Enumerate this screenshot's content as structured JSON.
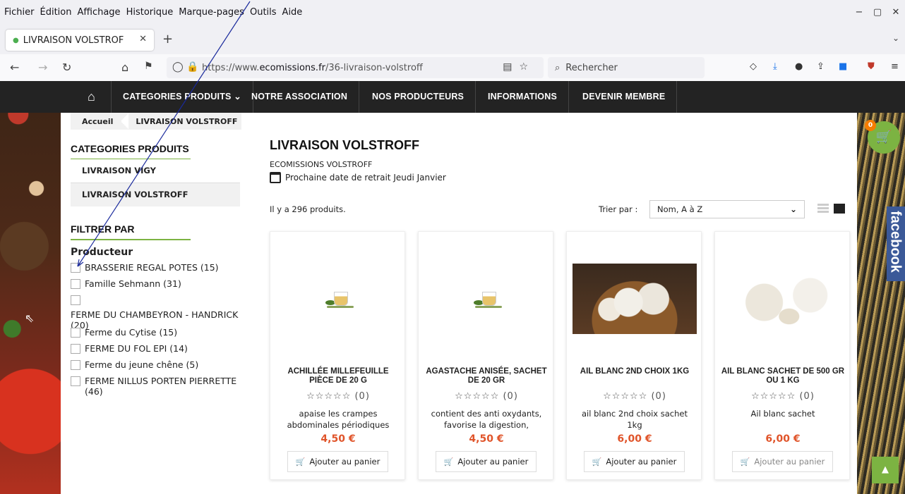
{
  "browser": {
    "menu": [
      "Fichier",
      "Édition",
      "Affichage",
      "Historique",
      "Marque-pages",
      "Outils",
      "Aide"
    ],
    "tab_title": "LIVRAISON VOLSTROF",
    "url_prefix": "https://www.",
    "url_domain": "ecomissions.fr",
    "url_path": "/36-livraison-volstroff",
    "search_placeholder": "Rechercher"
  },
  "nav": {
    "items": [
      "CATEGORIES PRODUITS ⌄",
      "NOTRE ASSOCIATION",
      "NOS PRODUCTEURS",
      "INFORMATIONS",
      "DEVENIR MEMBRE"
    ]
  },
  "breadcrumb": [
    "Accueil",
    "LIVRAISON VOLSTROFF"
  ],
  "sidebar": {
    "categories_title": "CATEGORIES PRODUITS",
    "categories": [
      "LIVRAISON VIGY",
      "LIVRAISON VOLSTROFF"
    ],
    "filter_title": "FILTRER PAR",
    "filter_subtitle": "Producteur",
    "producers": [
      "BRASSERIE REGAL POTES (15)",
      "Famille Sehmann (31)",
      "FERME DU CHAMBEYRON - HANDRICK (20)",
      "Ferme du Cytise (15)",
      "FERME DU FOL EPI (14)",
      "Ferme du jeune chêne (5)",
      "FERME NILLUS PORTEN PIERRETTE (46)"
    ]
  },
  "main": {
    "title": "LIVRAISON VOLSTROFF",
    "subtitle": "ECOMISSIONS VOLSTROFF",
    "pickup": "Prochaine date de retrait Jeudi Janvier",
    "count": "Il y a 296 produits.",
    "sort_label": "Trier par :",
    "sort_value": "Nom, A à Z"
  },
  "products": [
    {
      "name": "ACHILLÉE MILLEFEUILLE PIÈCE DE 20 G",
      "rating": "☆☆☆☆☆ (0)",
      "desc": "apaise les crampes abdominales périodiques",
      "price": "4,50 €",
      "button": "Ajouter au panier"
    },
    {
      "name": "AGASTACHE ANISÉE, SACHET DE 20 GR",
      "rating": "☆☆☆☆☆ (0)",
      "desc": "contient des anti oxydants, favorise la digestion,",
      "price": "4,50 €",
      "button": "Ajouter au panier"
    },
    {
      "name": "AIL BLANC 2ND CHOIX 1KG",
      "rating": "☆☆☆☆☆ (0)",
      "desc": "ail blanc 2nd choix sachet 1kg",
      "price": "6,00 €",
      "button": "Ajouter au panier"
    },
    {
      "name": "AIL BLANC  SACHET DE 500 GR OU 1 KG",
      "rating": "☆☆☆☆☆ (0)",
      "desc": "Ail blanc sachet",
      "price": "6,00 €",
      "button": "Ajouter au panier"
    }
  ],
  "cart_count": "0",
  "facebook_label": "facebook",
  "colors": {
    "accent": "#7cb342",
    "price": "#e0542a",
    "nav_bg": "#232323",
    "facebook": "#3b5998"
  }
}
